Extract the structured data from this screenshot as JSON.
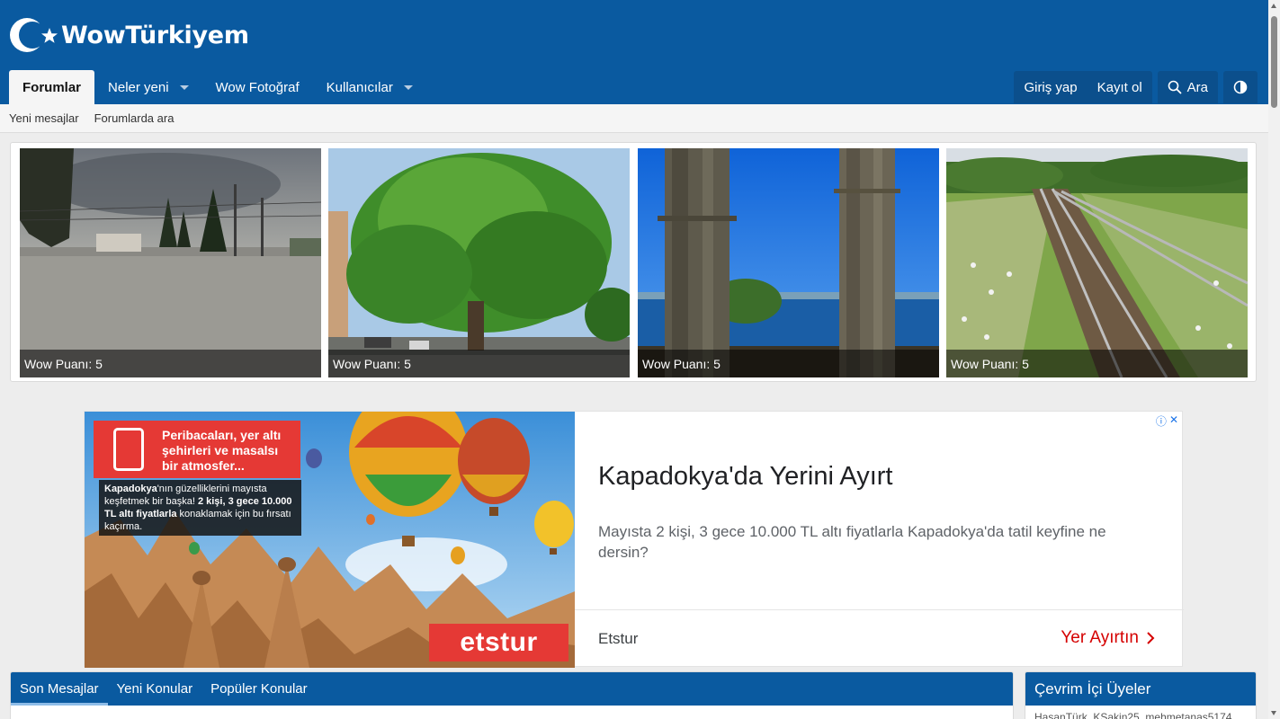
{
  "site": {
    "logo_text": "WowTürkiyem"
  },
  "nav": {
    "tabs": [
      {
        "label": "Forumlar",
        "active": true
      },
      {
        "label": "Neler yeni",
        "has_dropdown": true
      },
      {
        "label": "Wow Fotoğraf"
      },
      {
        "label": "Kullanıcılar",
        "has_dropdown": true
      }
    ],
    "login": "Giriş yap",
    "register": "Kayıt ol",
    "search": "Ara",
    "style_toggle_icon": "contrast-icon"
  },
  "subnav": {
    "links": [
      "Yeni mesajlar",
      "Forumlarda ara"
    ]
  },
  "gallery": {
    "photos": [
      {
        "caption": "Wow Puanı: 5",
        "subject": "evening road with cypress trees"
      },
      {
        "caption": "Wow Puanı: 5",
        "subject": "large green tree"
      },
      {
        "caption": "Wow Puanı: 5",
        "subject": "ancient columns by the sea"
      },
      {
        "caption": "Wow Puanı: 5",
        "subject": "railway through meadow"
      }
    ]
  },
  "ad": {
    "image_title": "Peribacaları, yer altı şehirleri ve masalsı bir atmosfer...",
    "image_text_1": "Kapadokya",
    "image_text_2": "'nın güzelliklerini mayısta keşfetmek bir başka! ",
    "image_text_3": "2 kişi, 3 gece 10.000 TL altı fiyatlarla",
    "image_text_4": " konaklamak için bu fırsatı kaçırma.",
    "brand_logo": "etstur",
    "headline": "Kapadokya'da Yerini Ayırt",
    "description": "Mayısta 2 kişi, 3 gece 10.000 TL altı fiyatlarla Kapadokya'da tatil keyfine ne dersin?",
    "advertiser": "Etstur",
    "cta": "Yer Ayırtın",
    "choices_icons": [
      "info-icon",
      "close-icon"
    ]
  },
  "widgets": {
    "tabs": [
      "Son Mesajlar",
      "Yeni Konular",
      "Popüler Konular"
    ],
    "online_title": "Çevrim İçi Üyeler",
    "online_members": "HasanTürk, KSakin25, mehmetanas5174,"
  },
  "colors": {
    "brand": "#0a5aa0",
    "accent_red": "#e53935",
    "cta_red": "#d50000"
  }
}
